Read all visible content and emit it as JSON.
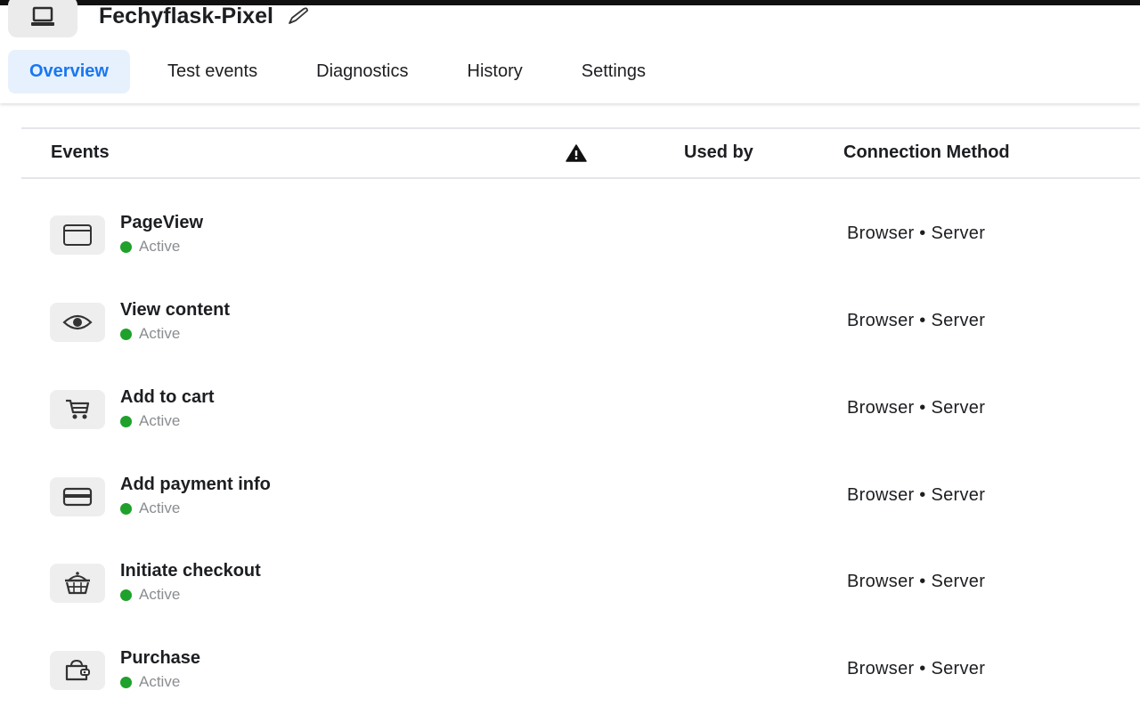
{
  "header": {
    "pixel_icon": "laptop-icon",
    "title": "Fechyflask-Pixel",
    "edit_icon": "pencil-icon"
  },
  "tabs": [
    {
      "label": "Overview",
      "active": true
    },
    {
      "label": "Test events",
      "active": false
    },
    {
      "label": "Diagnostics",
      "active": false
    },
    {
      "label": "History",
      "active": false
    },
    {
      "label": "Settings",
      "active": false
    }
  ],
  "table": {
    "columns": {
      "events": "Events",
      "warning_icon": "warning-triangle-icon",
      "used_by": "Used by",
      "connection_method": "Connection Method"
    },
    "rows": [
      {
        "icon": "browser-window-icon",
        "name": "PageView",
        "status": "Active",
        "used_by": "",
        "connection": "Browser • Server"
      },
      {
        "icon": "eye-icon",
        "name": "View content",
        "status": "Active",
        "used_by": "",
        "connection": "Browser • Server"
      },
      {
        "icon": "cart-icon",
        "name": "Add to cart",
        "status": "Active",
        "used_by": "",
        "connection": "Browser • Server"
      },
      {
        "icon": "credit-card-icon",
        "name": "Add payment info",
        "status": "Active",
        "used_by": "",
        "connection": "Browser • Server"
      },
      {
        "icon": "basket-icon",
        "name": "Initiate checkout",
        "status": "Active",
        "used_by": "",
        "connection": "Browser • Server"
      },
      {
        "icon": "purse-icon",
        "name": "Purchase",
        "status": "Active",
        "used_by": "",
        "connection": "Browser • Server"
      }
    ]
  },
  "colors": {
    "accent": "#1877f2",
    "active_tab_bg": "#e7f1fd",
    "status_active": "#1fa12b",
    "status_text": "#8a8d91"
  }
}
